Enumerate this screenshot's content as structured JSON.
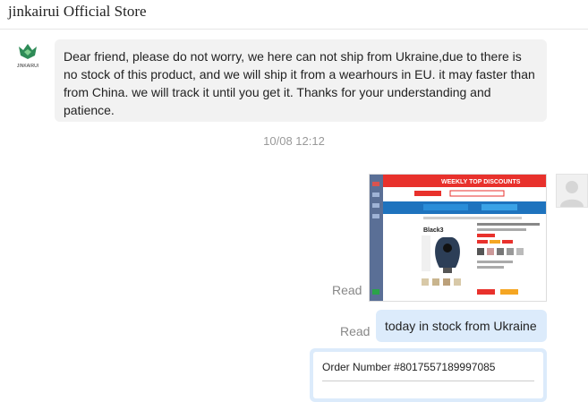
{
  "header": {
    "store_name": "jinkairui Official Store"
  },
  "store_avatar": {
    "icon": "store-logo-icon",
    "caption": "JINKAIRUI"
  },
  "messages": {
    "incoming_text": "Dear friend, please do not worry, we here can not ship from Ukraine,due to there is no stock of this product, and we will ship it from a wearhours in EU. it may faster than from China. we will track it until you get it. Thanks for your understanding and patience.",
    "timestamp": "10/08 12:12",
    "image_read_status": "Read",
    "text_read_status": "Read",
    "outgoing_text": "today in stock from Ukraine",
    "order_card_text": "Order Number #8017557189997085"
  },
  "screenshot_image": {
    "banner_text": "WEEKLY TOP DISCOUNTS",
    "product_variant": "Black3"
  },
  "colors": {
    "incoming_bubble": "#f2f2f2",
    "outgoing_bubble": "#dcebfb",
    "banner_red": "#e8312c",
    "brand_blue": "#1e73be"
  }
}
